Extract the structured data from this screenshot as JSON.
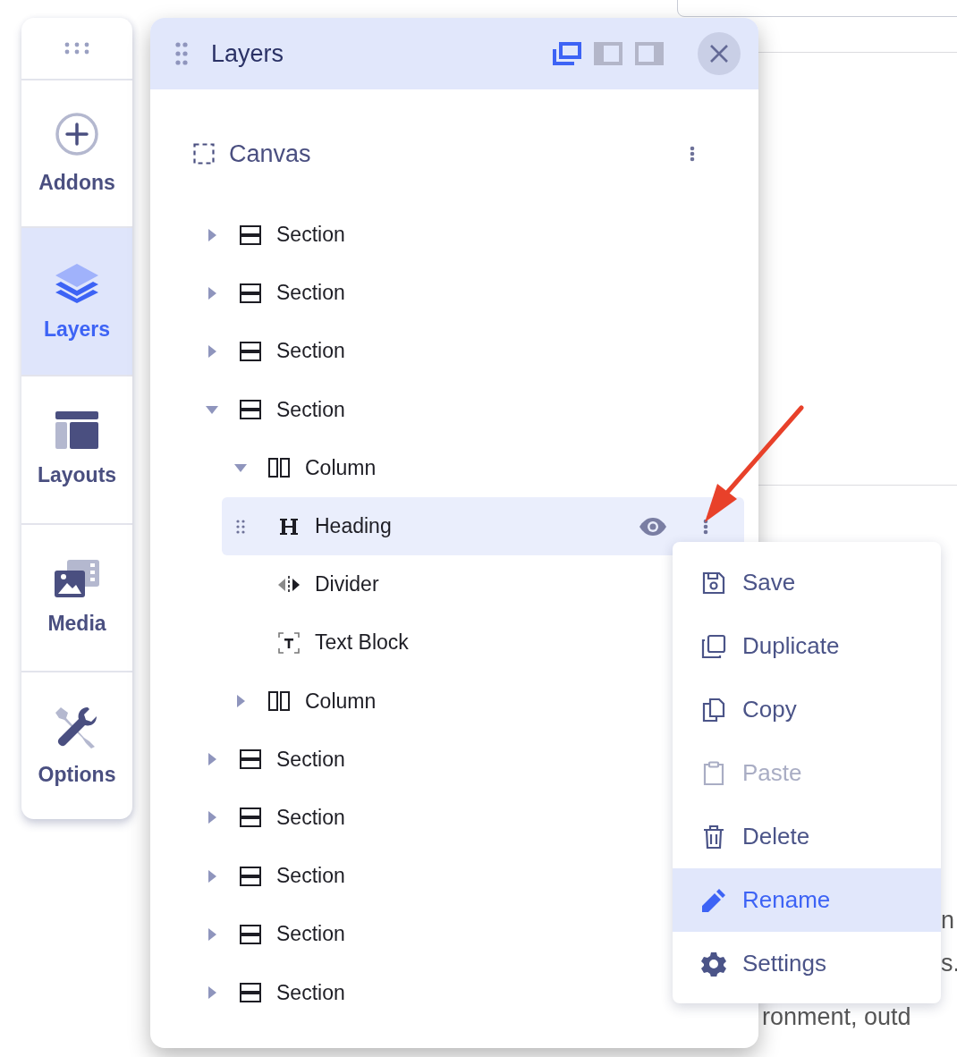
{
  "sidebar": {
    "items": [
      {
        "label": "Addons",
        "kind": "addons",
        "selected": false
      },
      {
        "label": "Layers",
        "kind": "layers",
        "selected": true
      },
      {
        "label": "Layouts",
        "kind": "layouts",
        "selected": false
      },
      {
        "label": "Media",
        "kind": "media",
        "selected": false
      },
      {
        "label": "Options",
        "kind": "options",
        "selected": false
      }
    ]
  },
  "panel": {
    "title": "Layers",
    "view_modes": [
      {
        "kind": "float",
        "selected": true
      },
      {
        "kind": "left",
        "selected": false
      },
      {
        "kind": "right",
        "selected": false
      }
    ]
  },
  "tree": {
    "label": "Canvas",
    "children": [
      {
        "label": "Section",
        "kind": "section",
        "expanded": false,
        "selected": false
      },
      {
        "label": "Section",
        "kind": "section",
        "expanded": false,
        "selected": false
      },
      {
        "label": "Section",
        "kind": "section",
        "expanded": false,
        "selected": false
      },
      {
        "label": "Section",
        "kind": "section",
        "expanded": true,
        "selected": false,
        "children": [
          {
            "label": "Column",
            "kind": "column",
            "expanded": true,
            "selected": false,
            "children": [
              {
                "label": "Heading",
                "kind": "heading",
                "selected": true
              },
              {
                "label": "Divider",
                "kind": "divider",
                "selected": false
              },
              {
                "label": "Text Block",
                "kind": "text",
                "selected": false
              }
            ]
          },
          {
            "label": "Column",
            "kind": "column",
            "expanded": false,
            "selected": false
          }
        ]
      },
      {
        "label": "Section",
        "kind": "section",
        "expanded": false,
        "selected": false
      },
      {
        "label": "Section",
        "kind": "section",
        "expanded": false,
        "selected": false
      },
      {
        "label": "Section",
        "kind": "section",
        "expanded": false,
        "selected": false
      },
      {
        "label": "Section",
        "kind": "section",
        "expanded": false,
        "selected": false
      },
      {
        "label": "Section",
        "kind": "section",
        "expanded": false,
        "selected": false
      }
    ]
  },
  "context_menu": {
    "items": [
      {
        "label": "Save",
        "kind": "save",
        "disabled": false,
        "selected": false
      },
      {
        "label": "Duplicate",
        "kind": "duplicate",
        "disabled": false,
        "selected": false
      },
      {
        "label": "Copy",
        "kind": "copy",
        "disabled": false,
        "selected": false
      },
      {
        "label": "Paste",
        "kind": "paste",
        "disabled": true,
        "selected": false
      },
      {
        "label": "Delete",
        "kind": "delete",
        "disabled": false,
        "selected": false
      },
      {
        "label": "Rename",
        "kind": "rename",
        "disabled": false,
        "selected": true
      },
      {
        "label": "Settings",
        "kind": "settings",
        "disabled": false,
        "selected": false
      }
    ]
  },
  "background_text": [
    "n",
    "s.",
    "ronment, outd"
  ]
}
